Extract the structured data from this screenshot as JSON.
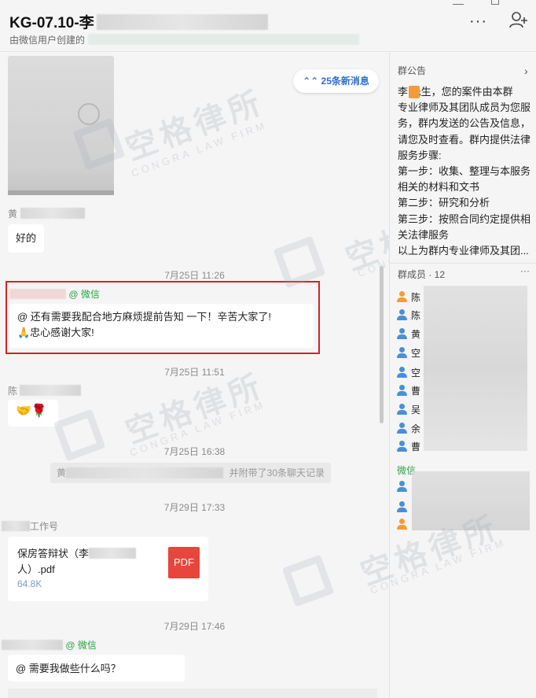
{
  "header": {
    "title": "KG-07.10-李",
    "subtitle": "由微信用户创建的",
    "more_glyph": "···"
  },
  "chat": {
    "new_msg_badge": "⌃⌃ 25条新消息",
    "messages": [
      {
        "sender": "黄",
        "text": "好的"
      },
      {
        "time": "7月25日 11:26",
        "wechat_tag": "@ 微信",
        "text_line1": "@        还有需要我配合地方麻烦提前告知 一下！辛苦大家了!",
        "text_line2": "🙏忠心感谢大家!"
      },
      {
        "time": "7月25日 11:51",
        "sender": "陈",
        "emoji": "🤝🌹"
      },
      {
        "time": "7月25日 16:38",
        "system": "黄",
        "system_suffix": "并附带了30条聊天记录"
      },
      {
        "time": "7月29日 17:33",
        "sender": "工作号",
        "file_name_line1": "保房答辩状（李",
        "file_name_line2": "人）.pdf",
        "file_size": "64.8K",
        "file_type": "PDF"
      },
      {
        "time": "7月29日 17:46",
        "wechat_tag": "@ 微信",
        "text": "@            需要我做些什么吗？"
      }
    ]
  },
  "watermark": {
    "cn": "空格律所",
    "en": "CONGRA LAW FIRM"
  },
  "panel": {
    "notice_title": "群公告",
    "notice_lines": [
      "李   先生，您的案件由本群",
      "专业律师及其团队成员为您服",
      "务，群内发送的公告及信息，",
      "请您及时查看。群内提供法律",
      "服务步骤:",
      "第一步：收集、整理与本服务",
      "相关的材料和文书",
      "第二步：研究和分析",
      "第三步：按照合同约定提供相",
      "关法律服务",
      "以上为群内专业律师及其团..."
    ],
    "members_title": "群成员 · 12",
    "members_more": "···",
    "members": [
      "陈",
      "陈",
      "黄",
      "空",
      "空",
      "曹",
      "吴",
      "余",
      "曹"
    ],
    "wechat_group_label": "微信",
    "colors": {
      "accent_blue": "#4a8fd8",
      "wechat_green": "#2ba245",
      "highlight_red": "#d32424",
      "pdf_red": "#e8453c"
    }
  }
}
